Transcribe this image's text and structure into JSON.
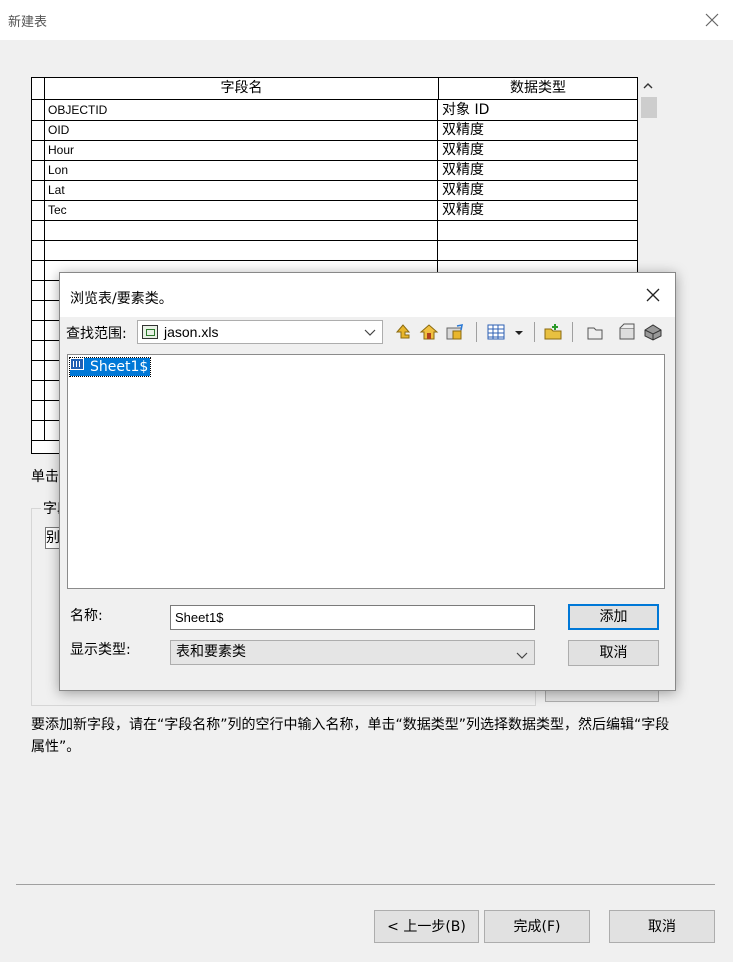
{
  "window": {
    "title": "新建表"
  },
  "grid": {
    "headers": [
      "字段名",
      "数据类型"
    ],
    "rows": [
      {
        "name": "OBJECTID",
        "type": "对象 ID"
      },
      {
        "name": "OID",
        "type": "双精度"
      },
      {
        "name": "Hour",
        "type": "双精度"
      },
      {
        "name": "Lon",
        "type": "双精度"
      },
      {
        "name": "Lat",
        "type": "双精度"
      },
      {
        "name": "Tec",
        "type": "双精度"
      }
    ]
  },
  "partial": {
    "hint": "单击",
    "group_label": "字段",
    "prop_value": "别"
  },
  "instructions": "要添加新字段，请在“字段名称”列的空行中输入名称，单击“数据类型”列选择数据类型，然后编辑“字段属性”。",
  "footer": {
    "prev": "< 上一步(B)",
    "finish": "完成(F)",
    "cancel": "取消"
  },
  "dialog": {
    "title": "浏览表/要素类。",
    "lookin_label": "查找范围:",
    "lookin_value": "jason.xls",
    "toolbar_icons": [
      "up-one-level-icon",
      "home-icon",
      "connect-folder-icon",
      "view-list-icon",
      "view-dropdown-icon",
      "new-item-icon",
      "catalog-icon",
      "toolbox-icon",
      "properties-icon"
    ],
    "items": [
      {
        "label": "Sheet1$",
        "icon": "table-icon",
        "selected": true
      }
    ],
    "name_label": "名称:",
    "name_value": "Sheet1$",
    "type_label": "显示类型:",
    "type_value": "表和要素类",
    "add_button": "添加",
    "cancel_button": "取消"
  },
  "colors": {
    "selection": "#0078d7",
    "window_bg": "#f0f0f0"
  }
}
